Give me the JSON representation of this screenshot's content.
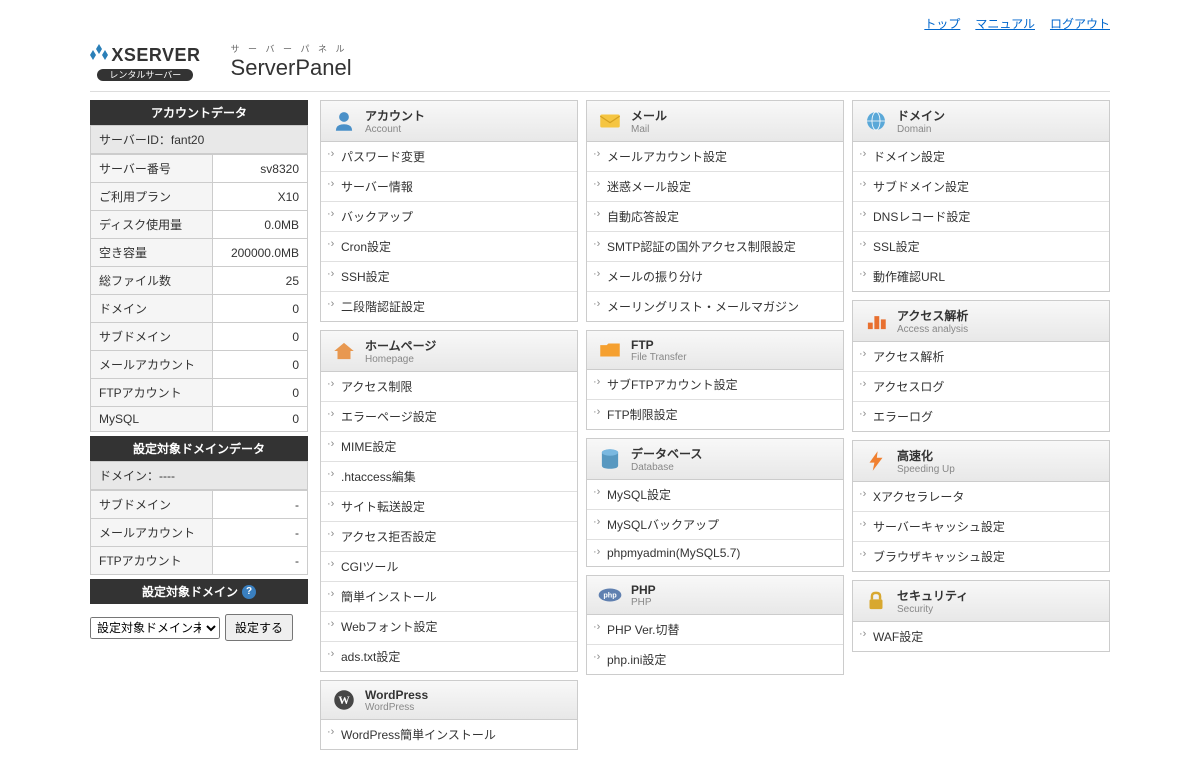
{
  "topLinks": {
    "top": "トップ",
    "manual": "マニュアル",
    "logout": "ログアウト"
  },
  "brand": {
    "name": "XSERVER",
    "rental": "レンタルサーバー"
  },
  "panel": {
    "kana": "サ ー バ ー パ ネ ル",
    "main": "ServerPanel"
  },
  "sidebar": {
    "accountHeader": "アカウントデータ",
    "serverIdLabel": "サーバーID：",
    "serverId": "fant20",
    "rows": [
      {
        "label": "サーバー番号",
        "value": "sv8320"
      },
      {
        "label": "ご利用プラン",
        "value": "X10"
      },
      {
        "label": "ディスク使用量",
        "value": "0.0MB"
      },
      {
        "label": "空き容量",
        "value": "200000.0MB"
      },
      {
        "label": "総ファイル数",
        "value": "25"
      },
      {
        "label": "ドメイン",
        "value": "0"
      },
      {
        "label": "サブドメイン",
        "value": "0"
      },
      {
        "label": "メールアカウント",
        "value": "0"
      },
      {
        "label": "FTPアカウント",
        "value": "0"
      },
      {
        "label": "MySQL",
        "value": "0"
      }
    ],
    "domainDataHeader": "設定対象ドメインデータ",
    "domainLabel": "ドメイン：",
    "domainValue": "----",
    "domainRows": [
      {
        "label": "サブドメイン",
        "value": "-"
      },
      {
        "label": "メールアカウント",
        "value": "-"
      },
      {
        "label": "FTPアカウント",
        "value": "-"
      }
    ],
    "targetDomainHeader": "設定対象ドメイン",
    "selectValue": "設定対象ドメイン未設",
    "setButton": "設定する"
  },
  "categories": {
    "account": {
      "jp": "アカウント",
      "en": "Account",
      "items": [
        "パスワード変更",
        "サーバー情報",
        "バックアップ",
        "Cron設定",
        "SSH設定",
        "二段階認証設定"
      ]
    },
    "mail": {
      "jp": "メール",
      "en": "Mail",
      "items": [
        "メールアカウント設定",
        "迷惑メール設定",
        "自動応答設定",
        "SMTP認証の国外アクセス制限設定",
        "メールの振り分け",
        "メーリングリスト・メールマガジン"
      ]
    },
    "domain": {
      "jp": "ドメイン",
      "en": "Domain",
      "items": [
        "ドメイン設定",
        "サブドメイン設定",
        "DNSレコード設定",
        "SSL設定",
        "動作確認URL"
      ]
    },
    "homepage": {
      "jp": "ホームページ",
      "en": "Homepage",
      "items": [
        "アクセス制限",
        "エラーページ設定",
        "MIME設定",
        ".htaccess編集",
        "サイト転送設定",
        "アクセス拒否設定",
        "CGIツール",
        "簡単インストール",
        "Webフォント設定",
        "ads.txt設定"
      ]
    },
    "ftp": {
      "jp": "FTP",
      "en": "File Transfer",
      "items": [
        "サブFTPアカウント設定",
        "FTP制限設定"
      ]
    },
    "access": {
      "jp": "アクセス解析",
      "en": "Access analysis",
      "items": [
        "アクセス解析",
        "アクセスログ",
        "エラーログ"
      ]
    },
    "wordpress": {
      "jp": "WordPress",
      "en": "WordPress",
      "items": [
        "WordPress簡単インストール"
      ]
    },
    "database": {
      "jp": "データベース",
      "en": "Database",
      "items": [
        "MySQL設定",
        "MySQLバックアップ",
        "phpmyadmin(MySQL5.7)"
      ]
    },
    "speed": {
      "jp": "高速化",
      "en": "Speeding Up",
      "items": [
        "Xアクセラレータ",
        "サーバーキャッシュ設定",
        "ブラウザキャッシュ設定"
      ]
    },
    "php": {
      "jp": "PHP",
      "en": "PHP",
      "items": [
        "PHP Ver.切替",
        "php.ini設定"
      ]
    },
    "security": {
      "jp": "セキュリティ",
      "en": "Security",
      "items": [
        "WAF設定"
      ]
    }
  }
}
